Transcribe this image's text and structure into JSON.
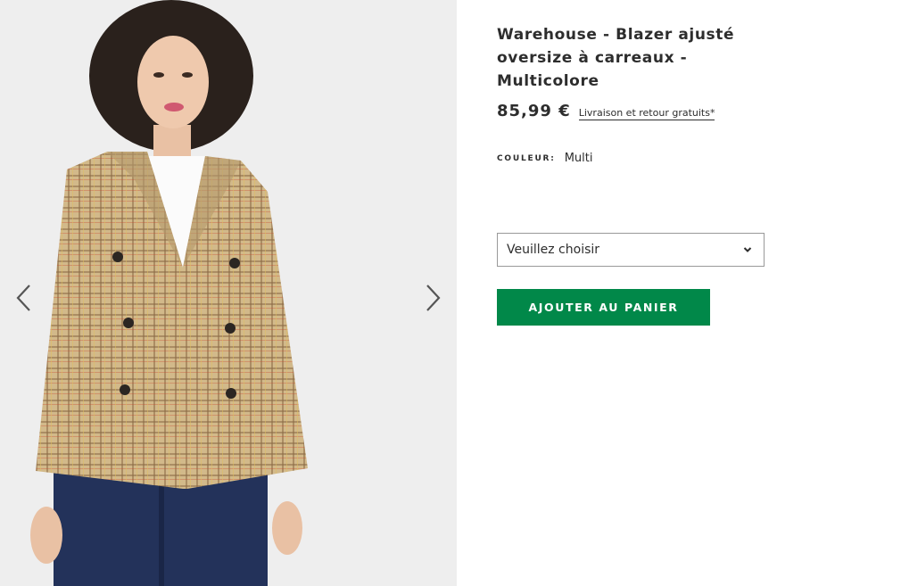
{
  "product": {
    "title": "Warehouse - Blazer ajusté oversize à carreaux - Multicolore",
    "price": "85,99 €",
    "shipping_link": "Livraison et retour gratuits*",
    "color_label": "COULEUR:",
    "color_value": "Multi"
  },
  "size_select": {
    "placeholder": "Veuillez choisir"
  },
  "actions": {
    "add_to_cart": "AJOUTER AU PANIER"
  },
  "gallery": {
    "prev_icon": "chevron-left-icon",
    "next_icon": "chevron-right-icon",
    "background": "#eeeeee"
  },
  "colors": {
    "add_button": "#018849",
    "text": "#2d2d2d",
    "select_border": "#999999"
  }
}
